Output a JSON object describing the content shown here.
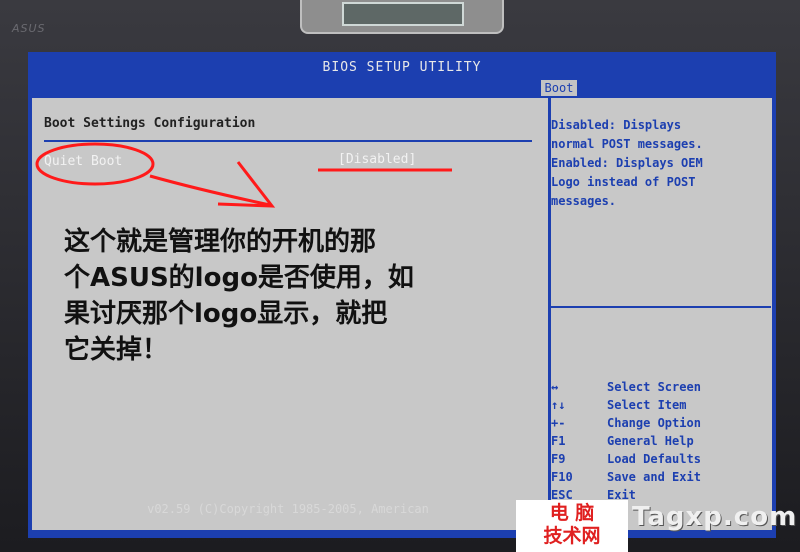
{
  "bezel": {
    "brand": "ASUS"
  },
  "bios": {
    "title": "BIOS SETUP UTILITY",
    "active_tab": "Boot",
    "section_title": "Boot Settings Configuration",
    "item": {
      "label": "Quiet Boot",
      "value": "[Disabled]"
    },
    "help_lines": [
      "Disabled: Displays",
      "normal POST messages.",
      "Enabled: Displays OEM",
      "Logo instead of POST",
      "messages."
    ],
    "keys": [
      {
        "key": "↔",
        "action": "Select Screen"
      },
      {
        "key": "↑↓",
        "action": "Select Item"
      },
      {
        "key": "+-",
        "action": "Change Option"
      },
      {
        "key": "F1",
        "action": "General Help"
      },
      {
        "key": "F9",
        "action": "Load Defaults"
      },
      {
        "key": "F10",
        "action": "Save and Exit"
      },
      {
        "key": "ESC",
        "action": "Exit"
      }
    ],
    "footer": "v02.59 (C)Copyright 1985-2005, American"
  },
  "annotation": {
    "lines": [
      "这个就是管理你的开机的那",
      "个ASUS的logo是否使用，如",
      "果讨厌那个logo显示，就把",
      "它关掉！"
    ],
    "color": "#ff1a1a"
  },
  "watermark": {
    "cn_line1": "电 脑",
    "cn_line2": "技术网",
    "en": "Tagxp.com"
  },
  "colors": {
    "bios_blue": "#1c3fb0",
    "panel_gray": "#c8c8c8",
    "annot_red": "#ff1a1a"
  }
}
